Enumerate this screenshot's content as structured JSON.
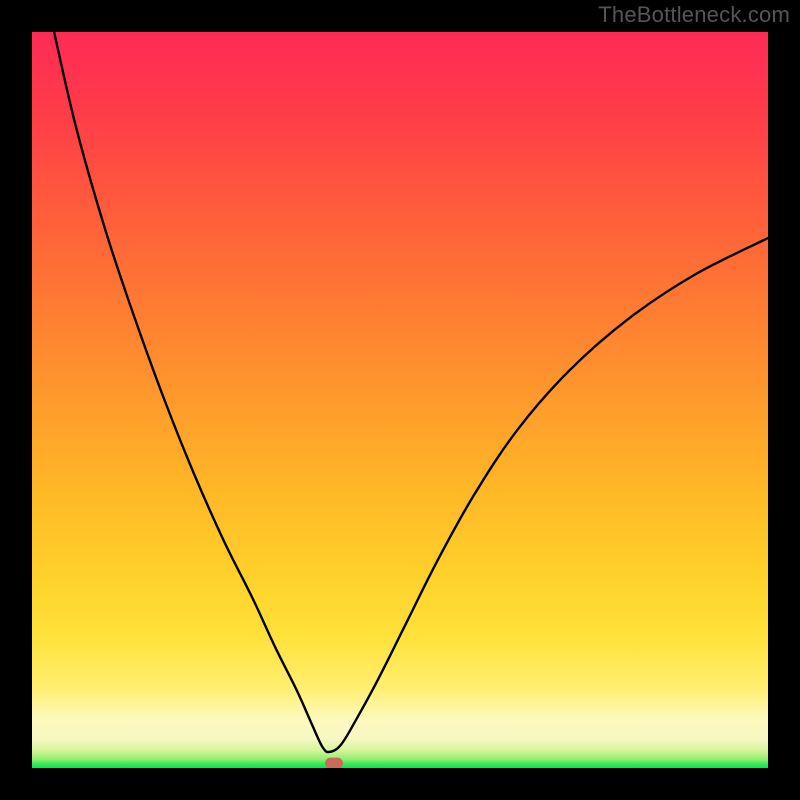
{
  "attribution": "TheBottleneck.com",
  "chart_data": {
    "type": "line",
    "title": "",
    "xlabel": "",
    "ylabel": "",
    "xlim": [
      0,
      100
    ],
    "ylim": [
      0,
      100
    ],
    "notch_x": 40,
    "marker": {
      "x": 41,
      "y": 0.8,
      "color": "#c96a5a"
    },
    "series": [
      {
        "name": "bottleneck-curve",
        "x": [
          3,
          6,
          10,
          14,
          18,
          22,
          26,
          30,
          33,
          36,
          38,
          39.5,
          40.5,
          42,
          44,
          47,
          51,
          55,
          60,
          66,
          73,
          81,
          90,
          100
        ],
        "values": [
          100,
          87,
          73,
          61,
          50,
          40,
          31,
          23,
          16.5,
          10.5,
          6,
          2.8,
          2.2,
          3.2,
          6.5,
          12,
          20,
          28,
          37,
          46,
          54,
          61,
          67,
          72
        ]
      }
    ],
    "background_gradient": {
      "stops": [
        {
          "pos": 0,
          "color": "#00e756"
        },
        {
          "pos": 0.5,
          "color": "#32ea52"
        },
        {
          "pos": 1.2,
          "color": "#92ef70"
        },
        {
          "pos": 2.4,
          "color": "#d6f59a"
        },
        {
          "pos": 4,
          "color": "#f6f8c2"
        },
        {
          "pos": 6.5,
          "color": "#fdf9bf"
        },
        {
          "pos": 11,
          "color": "#ffef6e"
        },
        {
          "pos": 18,
          "color": "#ffe13a"
        },
        {
          "pos": 27,
          "color": "#ffcf2a"
        },
        {
          "pos": 37,
          "color": "#ffb927"
        },
        {
          "pos": 48,
          "color": "#ff9f2a"
        },
        {
          "pos": 59,
          "color": "#ff8430"
        },
        {
          "pos": 70,
          "color": "#ff6a37"
        },
        {
          "pos": 80,
          "color": "#ff523f"
        },
        {
          "pos": 89,
          "color": "#ff3c49"
        },
        {
          "pos": 100,
          "color": "#ff2a55"
        }
      ]
    }
  }
}
